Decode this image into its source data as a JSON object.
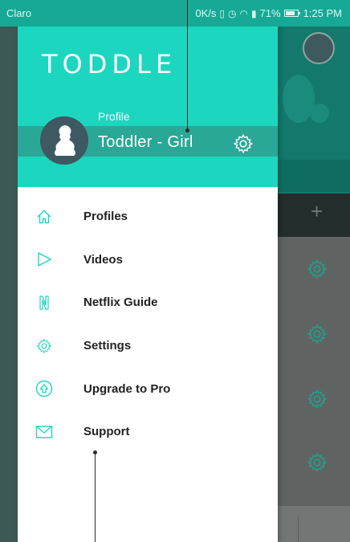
{
  "status_bar": {
    "carrier": "Claro",
    "speed": "0K/s",
    "battery": "71%",
    "time": "1:25 PM"
  },
  "drawer": {
    "brand": "TODDLE",
    "profile": {
      "caption": "Profile",
      "name": "Toddler - Girl"
    },
    "menu": [
      {
        "label": "Profiles",
        "icon": "home-icon"
      },
      {
        "label": "Videos",
        "icon": "play-icon"
      },
      {
        "label": "Netflix Guide",
        "icon": "netflix-icon"
      },
      {
        "label": "Settings",
        "icon": "gear-icon"
      },
      {
        "label": "Upgrade to Pro",
        "icon": "upload-icon"
      },
      {
        "label": "Support",
        "icon": "mail-icon"
      }
    ]
  },
  "colors": {
    "accent": "#1dd6bf",
    "status_bar": "#16a996",
    "profile_band": "#2aa897",
    "menu_icon": "#1dd6bf",
    "menu_text": "#222222"
  },
  "background_app": {
    "plus_label": "+"
  }
}
